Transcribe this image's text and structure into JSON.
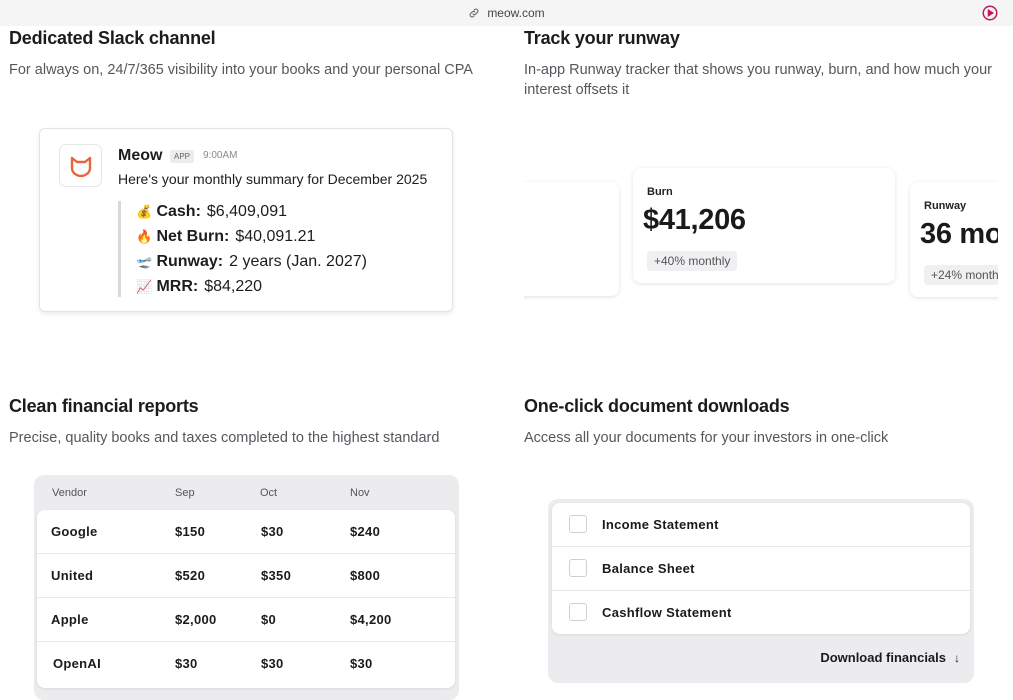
{
  "browser": {
    "url": "meow.com",
    "link_icon": "link-icon",
    "action_icon": "play-circle-icon",
    "accent": "#c2185b"
  },
  "features": {
    "slack": {
      "title": "Dedicated Slack channel",
      "description": "For always on, 24/7/365 visibility into your books and your personal CPA",
      "message": {
        "sender": "Meow",
        "badge": "APP",
        "time": "9:00AM",
        "text": "Here's your monthly summary for December 2025",
        "lines": [
          {
            "emoji": "💰",
            "label": "Cash:",
            "value": "$6,409,091"
          },
          {
            "emoji": "🔥",
            "label": "Net Burn:",
            "value": "$40,091.21"
          },
          {
            "emoji": "🛫",
            "label": "Runway:",
            "value": "2 years (Jan. 2027)"
          },
          {
            "emoji": "📈",
            "label": "MRR:",
            "value": "$84,220"
          }
        ],
        "avatar_icon": "cat-logo-icon",
        "avatar_color": "#e8643c"
      }
    },
    "runway": {
      "title": "Track your runway",
      "description": "In-app Runway tracker that shows you runway, burn, and how much your interest offsets it",
      "cards": [
        {
          "label": "Burn",
          "value": "$41,206",
          "change": "+40% monthly"
        },
        {
          "label": "Runway",
          "value": "36 mo",
          "change": "+24% month"
        }
      ]
    },
    "reports": {
      "title": "Clean financial reports",
      "description": "Precise, quality books and taxes completed to the highest standard",
      "table": {
        "columns": [
          "Vendor",
          "Sep",
          "Oct",
          "Nov"
        ],
        "rows": [
          [
            "Google",
            "$150",
            "$30",
            "$240"
          ],
          [
            "United",
            "$520",
            "$350",
            "$800"
          ],
          [
            "Apple",
            "$2,000",
            "$0",
            "$4,200"
          ],
          [
            "OpenAI",
            "$30",
            "$30",
            "$30"
          ]
        ]
      }
    },
    "downloads": {
      "title": "One-click document downloads",
      "description": "Access all your documents for your investors in one-click",
      "documents": [
        "Income Statement",
        "Balance Sheet",
        "Cashflow Statement"
      ],
      "button_label": "Download financials",
      "button_icon": "arrow-down-icon"
    }
  }
}
